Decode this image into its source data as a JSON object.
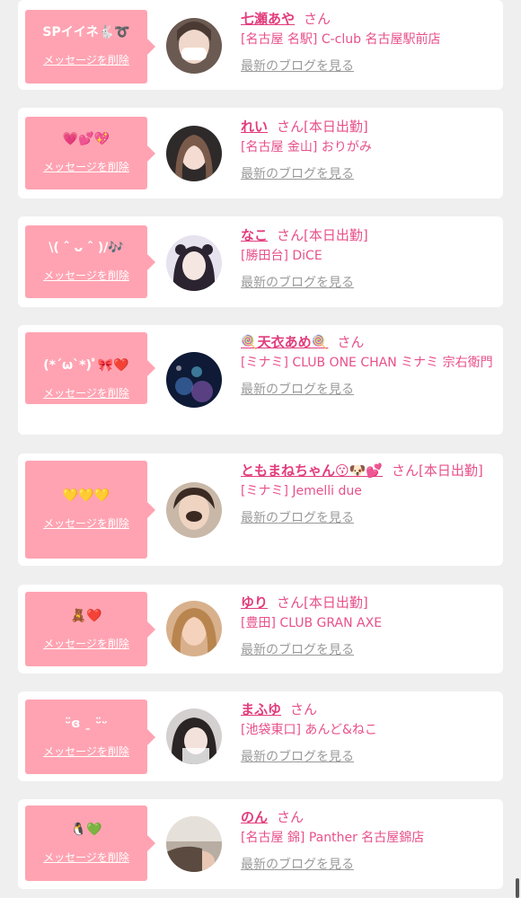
{
  "delete_label": "メッセージを削除",
  "blog_label": "最新のブログを見る",
  "colors": {
    "bubble": "#ffa3b2",
    "name": "#e23c7c",
    "text": "#e8508a",
    "muted": "#9a9a9a"
  },
  "entries": [
    {
      "message": "SPイイネ🐇➰",
      "name": "七瀬あや",
      "suffix": "さん",
      "shop": "[名古屋 名駅] C-club 名古屋駅前店"
    },
    {
      "message": "💗💕💖",
      "name": "れい",
      "suffix": "さん[本日出勤]",
      "shop": "[名古屋 金山] おりがみ"
    },
    {
      "message": "\\( ˆ ᴗ ˆ )/🎶",
      "name": "なこ",
      "suffix": "さん[本日出勤]",
      "shop": "[勝田台] DiCE"
    },
    {
      "message": "(*´ω`*)ﾟ🎀❤️",
      "name": "🍭天衣あめ🍭",
      "suffix": "さん",
      "shop": "[ミナミ] CLUB ONE CHAN ミナミ 宗右衛門"
    },
    {
      "message": "💛💛💛",
      "name": "ともまねちゃん😗🐶💕",
      "suffix": "さん[本日出勤]",
      "shop": "[ミナミ] Jemelli due"
    },
    {
      "message": "🧸❤️",
      "name": "ゆり",
      "suffix": "さん[本日出勤]",
      "shop": "[豊田] CLUB GRAN AXE"
    },
    {
      "message": "ᵕ̈ɞ ˍ ᵕ̈ᵕ",
      "name": "まふゆ",
      "suffix": "さん",
      "shop": "[池袋東口] あんど&ねこ"
    },
    {
      "message": "🐧💚",
      "name": "のん",
      "suffix": "さん",
      "shop": "[名古屋 錦] Panther 名古屋錦店"
    }
  ]
}
